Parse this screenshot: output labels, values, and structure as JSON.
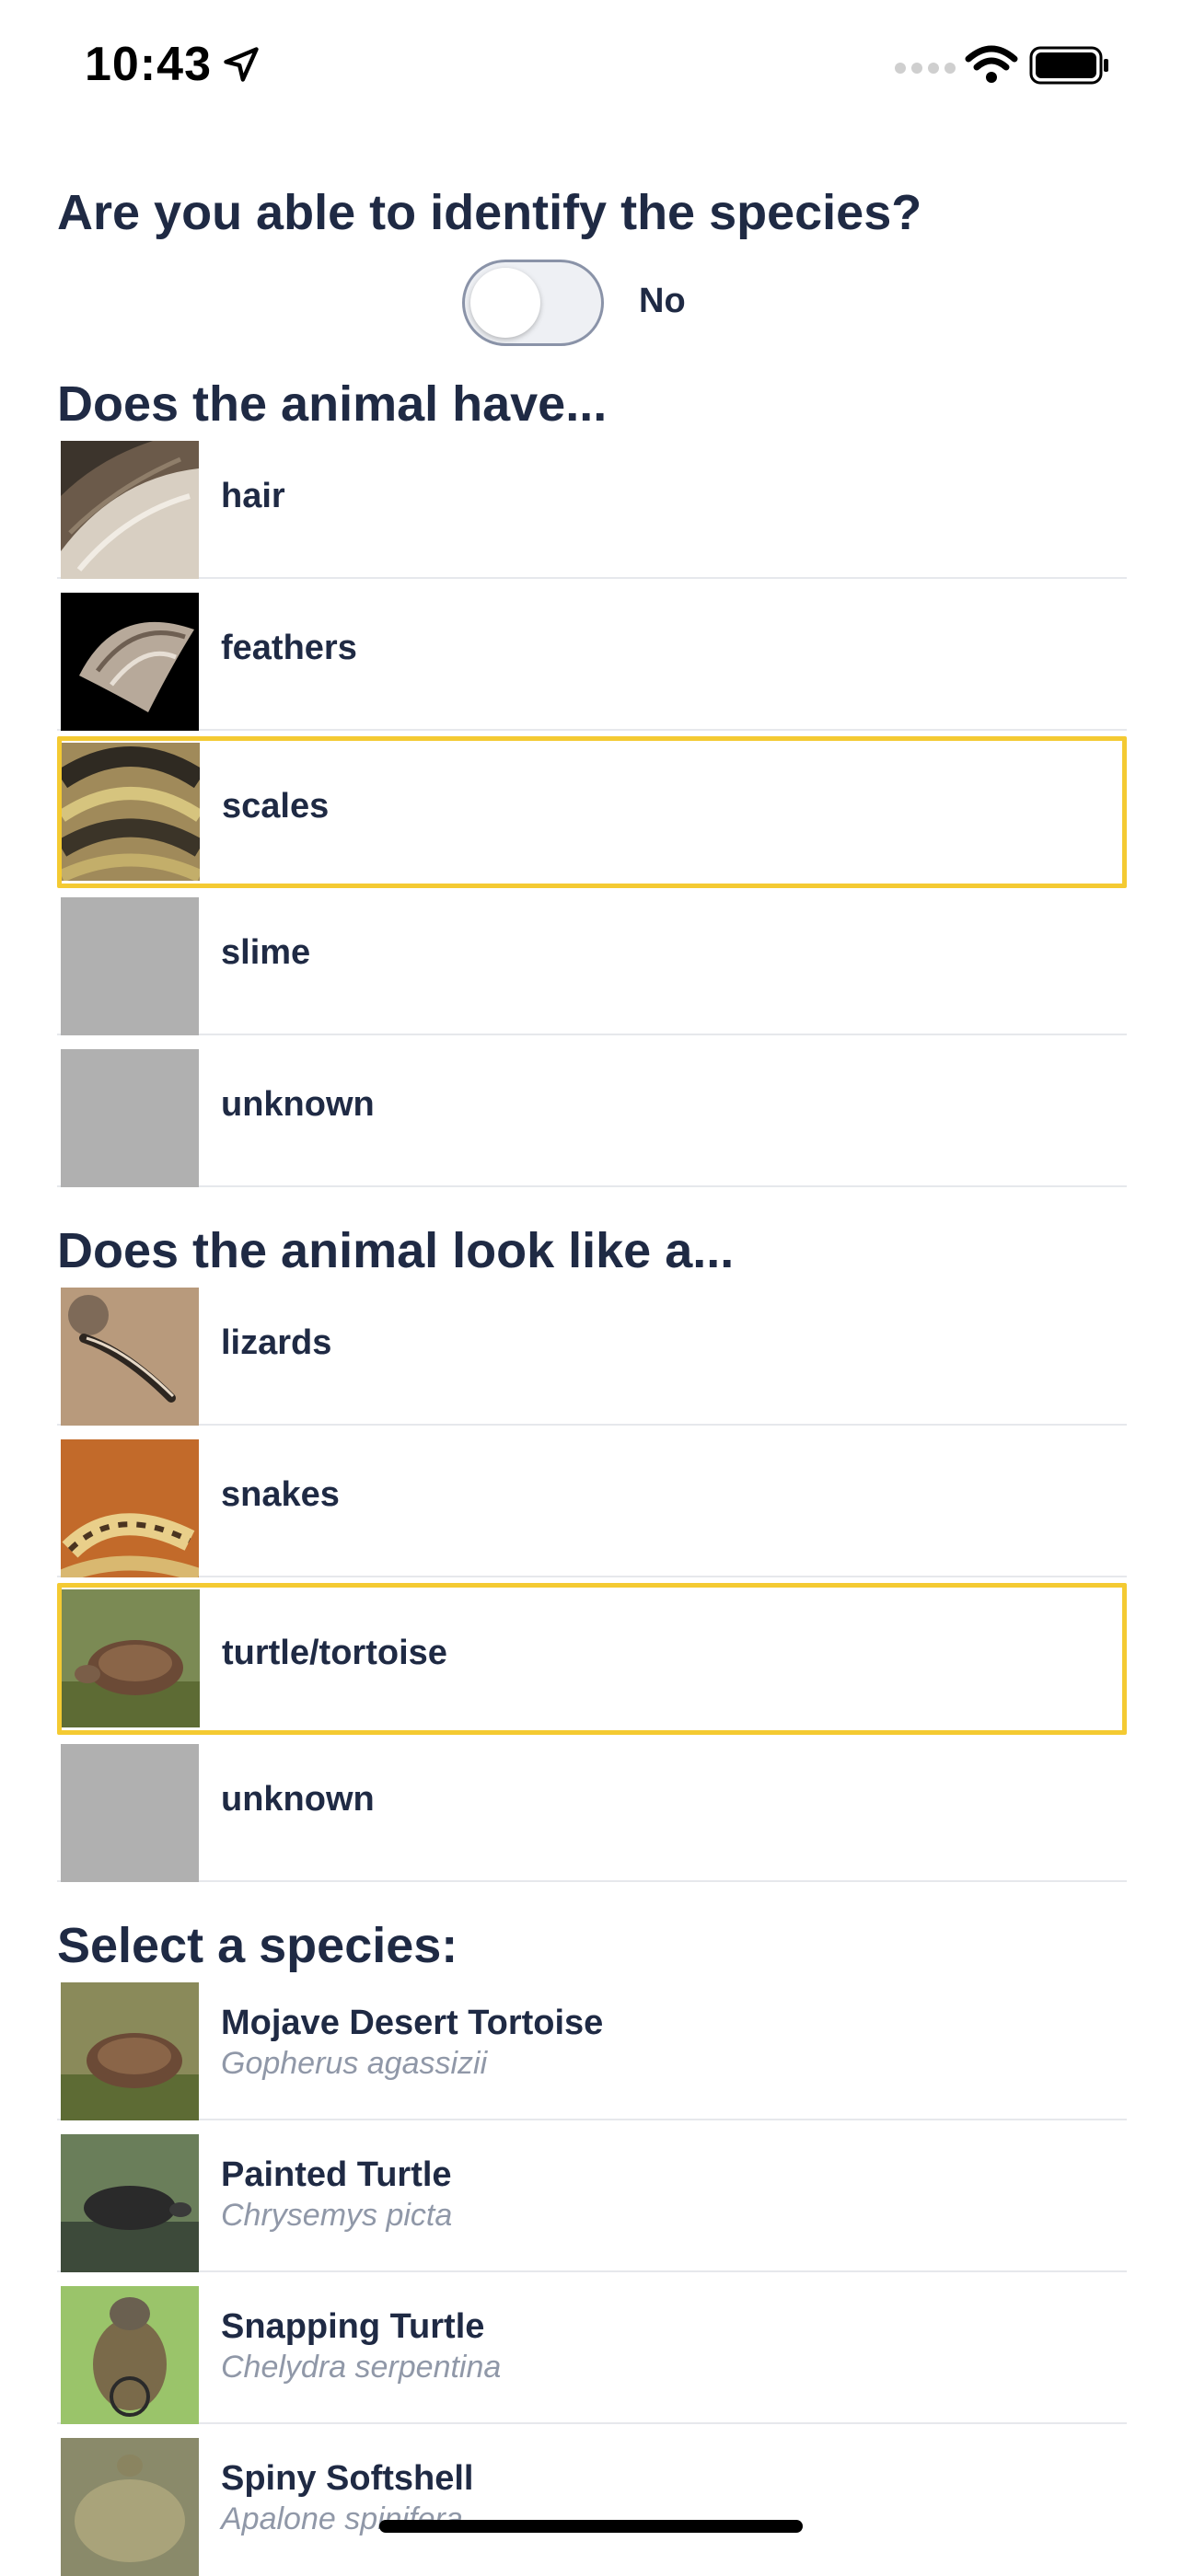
{
  "status_bar": {
    "time": "10:43"
  },
  "identify": {
    "question": "Are you able to identify the species?",
    "toggle_label": "No"
  },
  "covering": {
    "title": "Does the animal have...",
    "items": [
      {
        "label": "hair",
        "selected": false,
        "icon": "fur-image"
      },
      {
        "label": "feathers",
        "selected": false,
        "icon": "feather-image"
      },
      {
        "label": "scales",
        "selected": true,
        "icon": "scales-image"
      },
      {
        "label": "slime",
        "selected": false,
        "icon": "placeholder-image"
      },
      {
        "label": "unknown",
        "selected": false,
        "icon": "placeholder-image"
      }
    ]
  },
  "shape": {
    "title": "Does the animal look like a...",
    "items": [
      {
        "label": "lizards",
        "selected": false,
        "icon": "lizard-image"
      },
      {
        "label": "snakes",
        "selected": false,
        "icon": "snake-image"
      },
      {
        "label": "turtle/tortoise",
        "selected": true,
        "icon": "tortoise-image"
      },
      {
        "label": "unknown",
        "selected": false,
        "icon": "placeholder-image"
      }
    ]
  },
  "species": {
    "title": "Select a species:",
    "items": [
      {
        "name": "Mojave Desert Tortoise",
        "scientific": "Gopherus agassizii"
      },
      {
        "name": "Painted Turtle",
        "scientific": "Chrysemys picta"
      },
      {
        "name": "Snapping Turtle",
        "scientific": "Chelydra serpentina"
      },
      {
        "name": "Spiny Softshell",
        "scientific": "Apalone spinifera"
      }
    ]
  },
  "colors": {
    "accent_selected": "#f4ca32",
    "text": "#1f2a44",
    "secondary_text": "#9098a8"
  }
}
